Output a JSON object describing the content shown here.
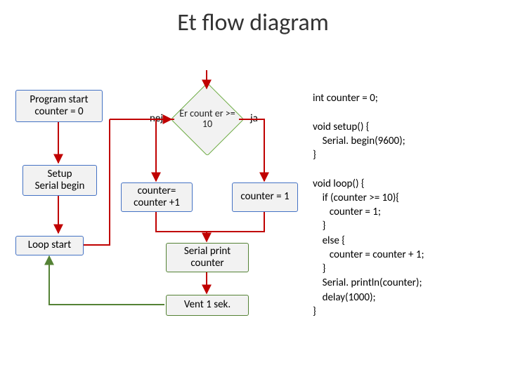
{
  "title": "Et flow diagram",
  "boxes": {
    "program_start": "Program start\ncounter = 0",
    "setup": "Setup\nSerial begin",
    "loop_start": "Loop start",
    "decision": "Er count er >= 10",
    "inc": "counter= counter +1",
    "reset": "counter = 1",
    "print": "Serial print counter",
    "wait": "Vent 1 sek."
  },
  "labels": {
    "no": "nej",
    "yes": "ja"
  },
  "code": "int counter = 0;\n\nvoid setup() {\n    Serial. begin(9600);\n}\n\nvoid loop() {\n    if (counter >= 10){\n       counter = 1;\n    }\n    else {\n       counter = counter + 1;\n    }\n    Serial. println(counter);\n    delay(1000);\n}"
}
